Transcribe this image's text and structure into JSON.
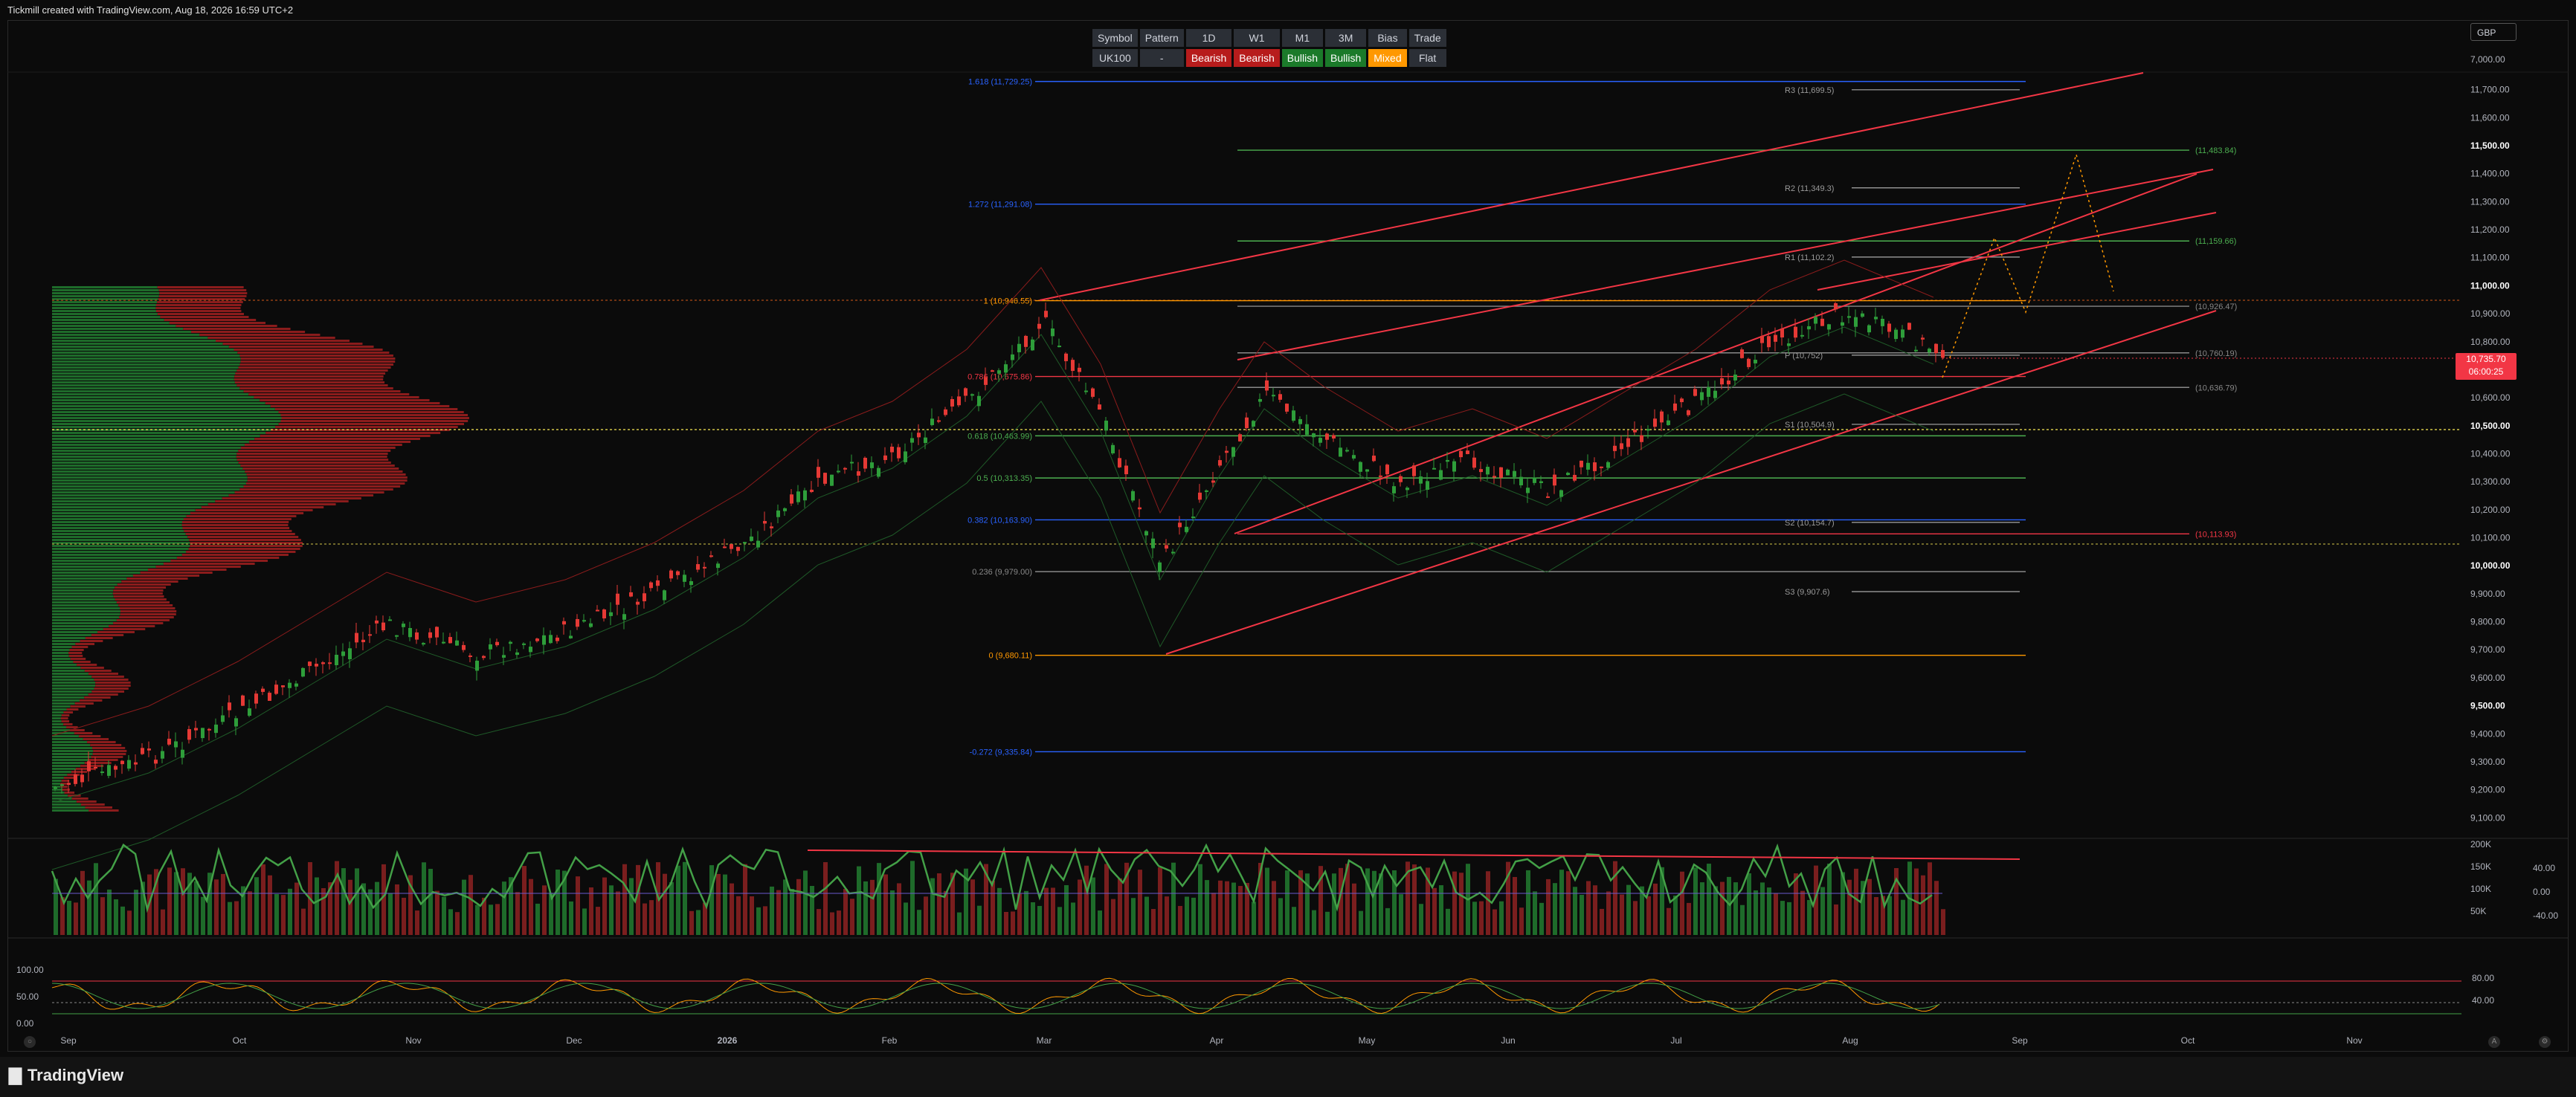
{
  "caption": "Tickmill created with TradingView.com, Aug 18, 2026 16:59 UTC+2",
  "brand": "TradingView",
  "currency": "GBP",
  "price_tag": {
    "price": "10,735.70",
    "countdown": "06:00:25"
  },
  "signal_table": {
    "headers": [
      "Symbol",
      "Pattern",
      "1D",
      "W1",
      "M1",
      "3M",
      "Bias",
      "Trade"
    ],
    "values": [
      "UK100",
      "-",
      "Bearish",
      "Bearish",
      "Bullish",
      "Bullish",
      "Mixed",
      "Flat"
    ],
    "colors": {
      "bearish": "#b71c1c",
      "bullish": "#1b7a2a",
      "mixed": "#ff9800",
      "neutral": "#2b2f36"
    }
  },
  "price_axis": {
    "labels": [
      "7,000.00",
      "11,700.00",
      "11,600.00",
      "11,500.00",
      "11,400.00",
      "11,300.00",
      "11,200.00",
      "11,100.00",
      "11,000.00",
      "10,900.00",
      "10,800.00",
      "10,700.00",
      "10,600.00",
      "10,500.00",
      "10,400.00",
      "10,300.00",
      "10,200.00",
      "10,100.00",
      "10,000.00",
      "9,900.00",
      "9,800.00",
      "9,700.00",
      "9,600.00",
      "9,500.00",
      "9,400.00",
      "9,300.00",
      "9,200.00",
      "9,100.00"
    ],
    "bold": [
      "11,500.00",
      "11,000.00",
      "10,500.00",
      "10,000.00",
      "9,500.00"
    ]
  },
  "time_axis": [
    "Sep",
    "Oct",
    "Nov",
    "Dec",
    "2026",
    "Feb",
    "Mar",
    "Apr",
    "May",
    "Jun",
    "Jul",
    "Aug",
    "Sep",
    "Oct",
    "Nov"
  ],
  "fib_levels": [
    {
      "label": "1.618 (11,729.25)",
      "price": 11729.25,
      "color": "#2962ff"
    },
    {
      "label": "1.272 (11,291.08)",
      "price": 11291.08,
      "color": "#2962ff"
    },
    {
      "label": "1 (10,946.55)",
      "price": 10946.55,
      "color": "#ff9800"
    },
    {
      "label": "0.786 (10,675.86)",
      "price": 10675.86,
      "color": "#f23645"
    },
    {
      "label": "0.618 (10,463.99)",
      "price": 10463.99,
      "color": "#4caf50"
    },
    {
      "label": "0.5 (10,313.35)",
      "price": 10313.35,
      "color": "#4caf50"
    },
    {
      "label": "0.382 (10,163.90)",
      "price": 10163.9,
      "color": "#2962ff"
    },
    {
      "label": "0.236 (9,979.00)",
      "price": 9979.0,
      "color": "#888888"
    },
    {
      "label": "0 (9,680.11)",
      "price": 9680.11,
      "color": "#ff9800"
    },
    {
      "label": "-0.272 (9,335.84)",
      "price": 9335.84,
      "color": "#2962ff"
    }
  ],
  "pivots": [
    {
      "label": "R3 (11,699.5)",
      "price": 11699.5
    },
    {
      "label": "R2 (11,349.3)",
      "price": 11349.3
    },
    {
      "label": "R1 (11,102.2)",
      "price": 11102.2
    },
    {
      "label": "P (10,752)",
      "price": 10752
    },
    {
      "label": "S1 (10,504.9)",
      "price": 10504.9
    },
    {
      "label": "S2 (10,154.7)",
      "price": 10154.7
    },
    {
      "label": "S3 (9,907.6)",
      "price": 9907.6
    }
  ],
  "targets": [
    {
      "label": "(11,483.84)",
      "price": 11483.84,
      "color": "#4caf50"
    },
    {
      "label": "(11,159.66)",
      "price": 11159.66,
      "color": "#4caf50"
    },
    {
      "label": "(10,926.47)",
      "price": 10926.47,
      "color": "#888888"
    },
    {
      "label": "(10,760.19)",
      "price": 10760.19,
      "color": "#888888"
    },
    {
      "label": "(10,636.79)",
      "price": 10636.79,
      "color": "#888888"
    },
    {
      "label": "(10,113.93)",
      "price": 10113.93,
      "color": "#f23645"
    }
  ],
  "volume_axis": {
    "labels": [
      "200K",
      "150K",
      "100K",
      "50K"
    ],
    "osc": [
      "40.00",
      "0.00",
      "-40.00"
    ]
  },
  "stoch_axis": {
    "left": [
      "100.00",
      "50.00",
      "0.00"
    ],
    "right": [
      "80.00",
      "40.00"
    ]
  },
  "colors": {
    "up": "#26a69a",
    "down": "#f23645",
    "green": "#2e9e3a",
    "red": "#e53935",
    "bg": "#0b0b0b",
    "grid": "#1e1e1e"
  }
}
